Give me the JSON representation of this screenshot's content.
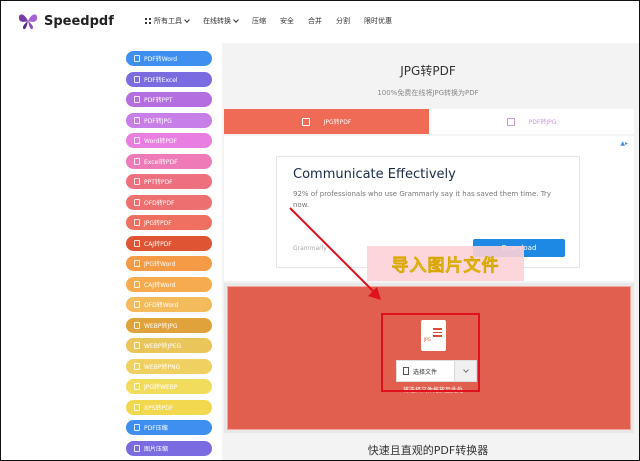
{
  "brand": {
    "name": "Speedpdf"
  },
  "nav": [
    {
      "label": "所有工具",
      "icon": "grid-icon",
      "caret": true
    },
    {
      "label": "在线转换",
      "caret": true
    },
    {
      "label": "压缩"
    },
    {
      "label": "安全"
    },
    {
      "label": "合并"
    },
    {
      "label": "分割"
    },
    {
      "label": "限时优惠"
    }
  ],
  "sidebar": {
    "items": [
      {
        "label": "PDF转Word",
        "color": "#3f8ff0"
      },
      {
        "label": "PDF转Excel",
        "color": "#7b6be0"
      },
      {
        "label": "PDF转PPT",
        "color": "#b56ee0"
      },
      {
        "label": "PDF转JPG",
        "color": "#c77ee6"
      },
      {
        "label": "Word转PDF",
        "color": "#e87ee0"
      },
      {
        "label": "Excel转PDF",
        "color": "#ee7bb8"
      },
      {
        "label": "PPT转PDF",
        "color": "#ee6f7e"
      },
      {
        "label": "OFD转PDF",
        "color": "#ee6f6f"
      },
      {
        "label": "JPG转PDF",
        "color": "#ef7060"
      },
      {
        "label": "CAJ转PDF",
        "color": "#df5433"
      },
      {
        "label": "JPG转Word",
        "color": "#f59a45"
      },
      {
        "label": "CAJ转Word",
        "color": "#f6ab4e"
      },
      {
        "label": "OFD转Word",
        "color": "#f4bb5c"
      },
      {
        "label": "WEBP转JPG",
        "color": "#e0a23a"
      },
      {
        "label": "WEBP转JPEG",
        "color": "#eac65a"
      },
      {
        "label": "WEBP转PNG",
        "color": "#efd060"
      },
      {
        "label": "JPG转WEBP",
        "color": "#f2dc5c"
      },
      {
        "label": "XPS转PDF",
        "color": "#f2d84e"
      },
      {
        "label": "PDF压缩",
        "color": "#3f8ff0"
      },
      {
        "label": "图片压缩",
        "color": "#7b6be0"
      }
    ]
  },
  "main": {
    "title": "JPG转PDF",
    "subtitle": "100%免费在线将JPG转换为PDF",
    "tabs": [
      {
        "label": "JPG转PDF",
        "active": true
      },
      {
        "label": "PDF转JPG",
        "active": false
      }
    ]
  },
  "ad": {
    "badge": "▲▸",
    "title": "Communicate Effectively",
    "text": "92% of professionals who use Grammarly say it has saved them time. Try now.",
    "brand": "Grammarly",
    "button": "Download"
  },
  "upload": {
    "file_type": "JPG",
    "select_label": "选择文件",
    "hint": "将选择文件拖放至此处"
  },
  "annotation": "导入图片文件",
  "bottom_title": "快速且直观的PDF转换器",
  "colors": {
    "accent": "#ef6b55",
    "upload_bg": "#e15f4e",
    "annotation_box": "#e0111e"
  }
}
